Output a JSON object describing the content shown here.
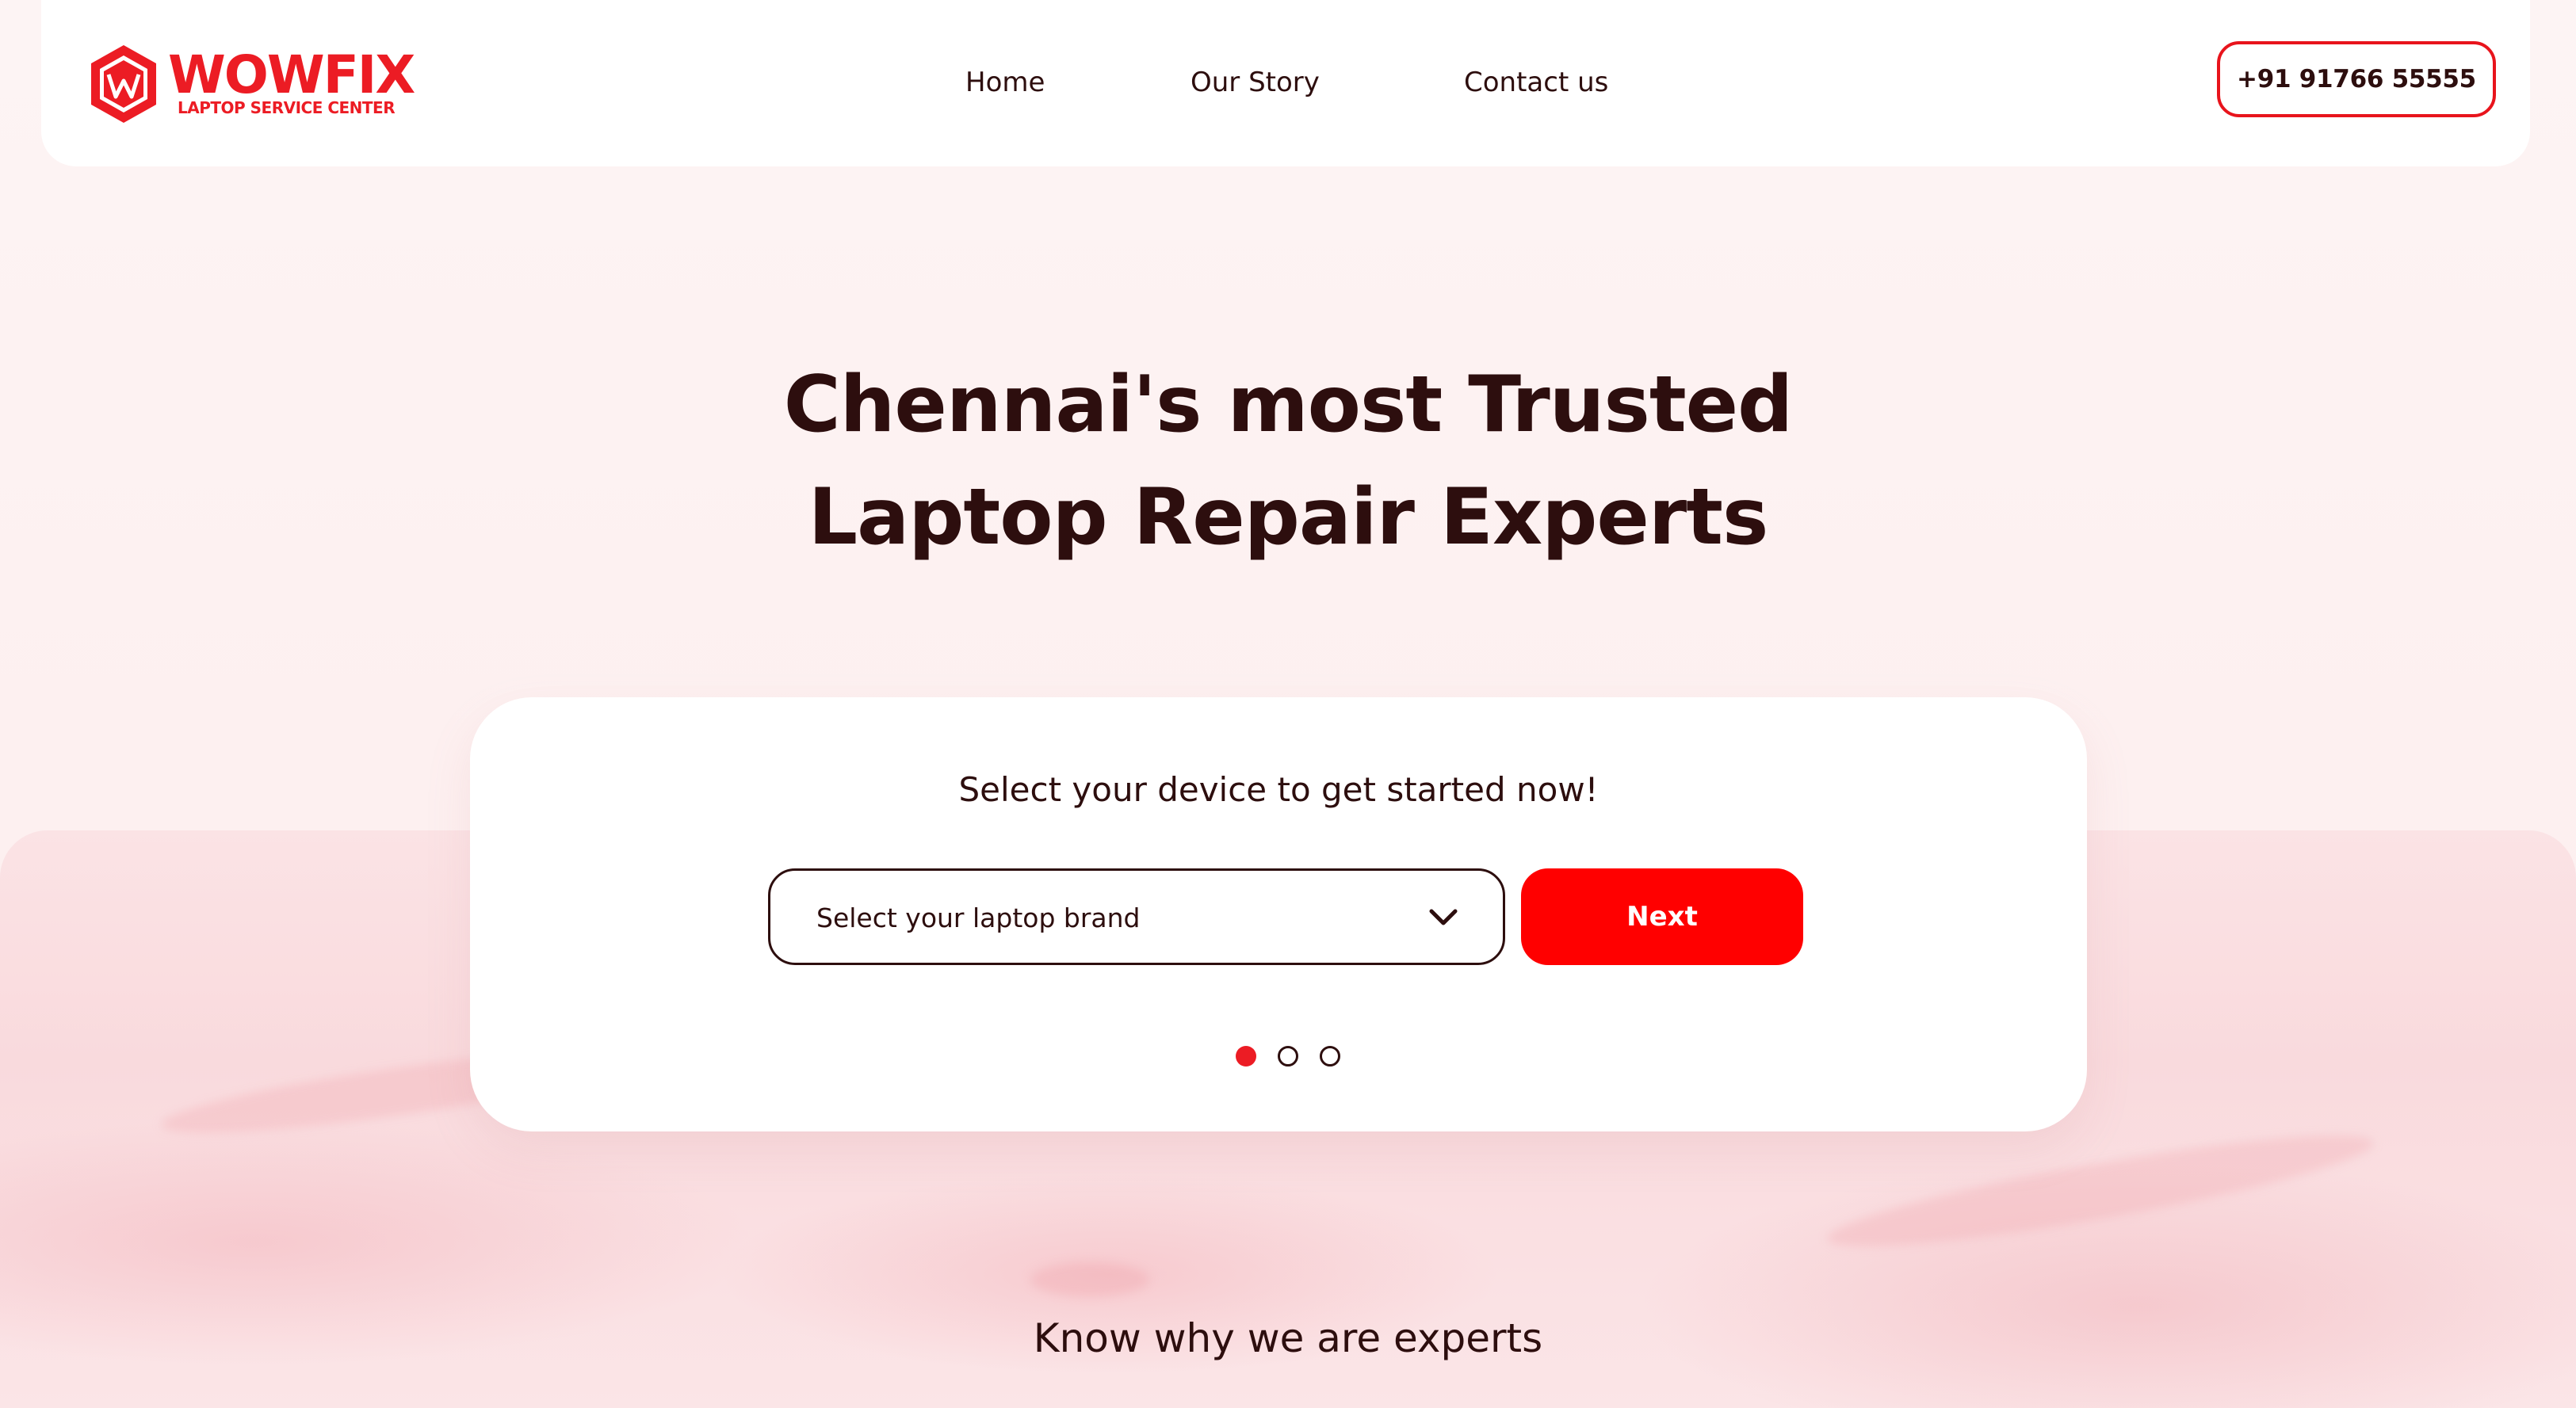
{
  "brand": {
    "name": "WOWFIX",
    "tagline": "LAPTOP SERVICE CENTER",
    "color": "#ec1c24"
  },
  "nav": {
    "items": [
      {
        "label": "Home"
      },
      {
        "label": "Our Story"
      },
      {
        "label": "Contact us"
      }
    ],
    "phone_label": "+91 91766 55555"
  },
  "hero": {
    "title_line_1": "Chennai's most Trusted",
    "title_line_2": "Laptop Repair Experts"
  },
  "device_form": {
    "prompt": "Select your device to get started now!",
    "brand_select": {
      "selected": "Select your laptop brand",
      "icon": "chevron-down-icon"
    },
    "next_label": "Next",
    "steps": {
      "total": 3,
      "current": 1
    }
  },
  "section": {
    "experts_heading": "Know why we are experts"
  },
  "colors": {
    "accent": "#ff0000",
    "text": "#2d0e0e",
    "background": "#fdf4f4"
  }
}
